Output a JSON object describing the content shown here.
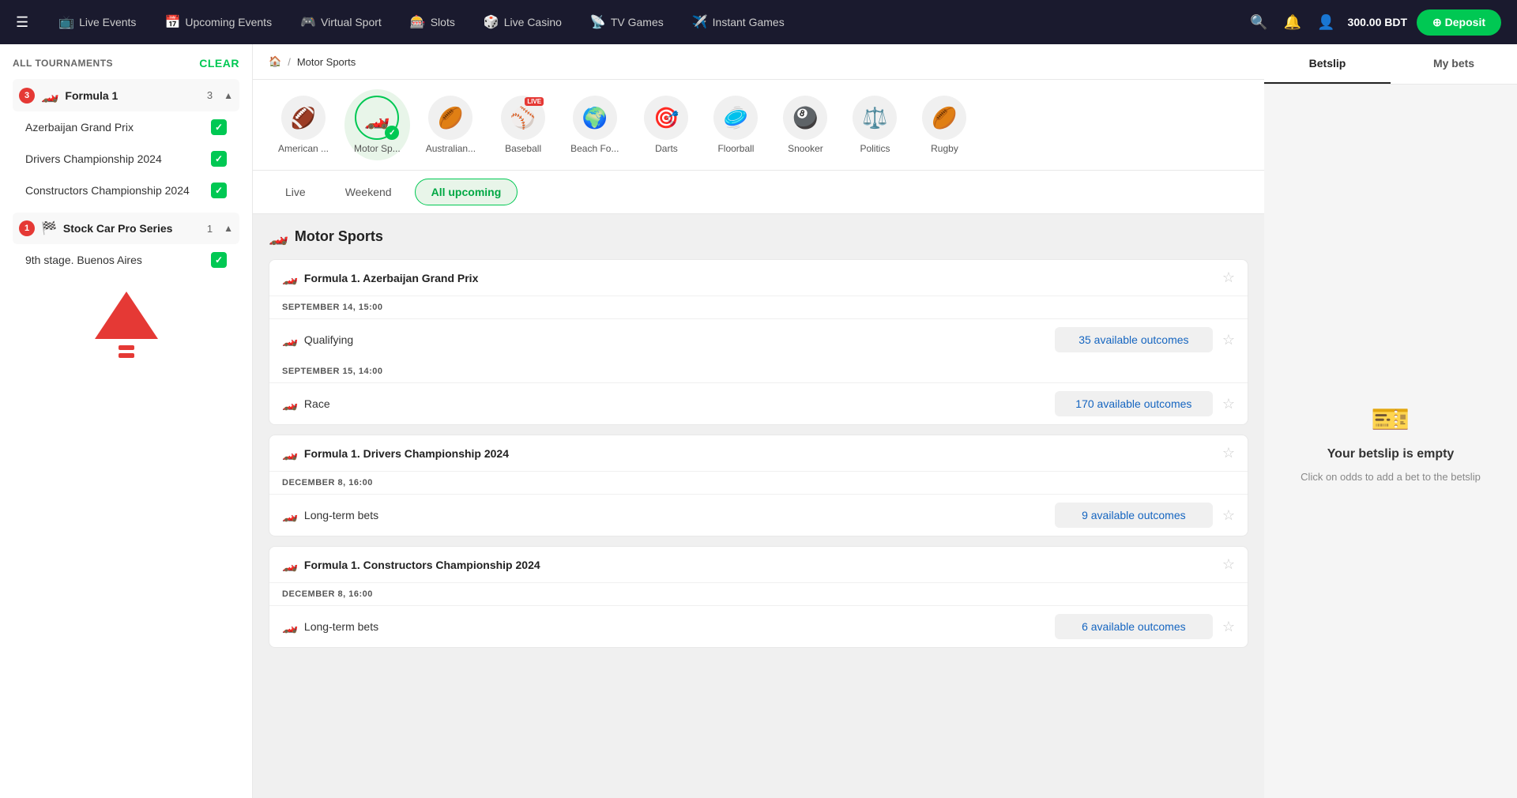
{
  "nav": {
    "hamburger": "☰",
    "items": [
      {
        "id": "live-events",
        "icon": "📺",
        "label": "Live Events"
      },
      {
        "id": "upcoming-events",
        "icon": "📅",
        "label": "Upcoming Events"
      },
      {
        "id": "virtual-sport",
        "icon": "🎮",
        "label": "Virtual Sport"
      },
      {
        "id": "slots",
        "icon": "🎰",
        "label": "Slots"
      },
      {
        "id": "live-casino",
        "icon": "🎲",
        "label": "Live Casino"
      },
      {
        "id": "tv-games",
        "icon": "📡",
        "label": "TV Games"
      },
      {
        "id": "instant-games",
        "icon": "✈️",
        "label": "Instant Games"
      }
    ],
    "balance": "300.00 BDT",
    "deposit_label": "⊕ Deposit"
  },
  "sidebar": {
    "header": "ALL TOURNAMENTS",
    "clear_label": "Clear",
    "groups": [
      {
        "id": "formula1",
        "badge": "3",
        "icon": "🏎️",
        "name": "Formula 1",
        "count": "3",
        "sub_items": [
          {
            "id": "azerbaijan",
            "label": "Azerbaijan Grand Prix",
            "checked": true
          },
          {
            "id": "drivers",
            "label": "Drivers Championship 2024",
            "checked": true
          },
          {
            "id": "constructors",
            "label": "Constructors Championship 2024",
            "checked": true
          }
        ]
      },
      {
        "id": "stockcar",
        "badge": "1",
        "icon": "🏁",
        "name": "Stock Car Pro Series",
        "count": "1",
        "sub_items": [
          {
            "id": "buenosaires",
            "label": "9th stage. Buenos Aires",
            "checked": true
          }
        ]
      }
    ]
  },
  "breadcrumb": {
    "home_icon": "🏠",
    "separator": "/",
    "current": "Motor Sports"
  },
  "sport_icons": [
    {
      "id": "american",
      "icon": "🏈",
      "label": "American ...",
      "active": false,
      "live": false
    },
    {
      "id": "motorsports",
      "icon": "🏎️",
      "label": "Motor Sp...",
      "active": true,
      "live": false
    },
    {
      "id": "australian",
      "icon": "🏉",
      "label": "Australian...",
      "active": false,
      "live": false
    },
    {
      "id": "baseball",
      "icon": "⚾",
      "label": "Baseball",
      "active": false,
      "live": true
    },
    {
      "id": "beachfootball",
      "icon": "🌍",
      "label": "Beach Fo...",
      "active": false,
      "live": false
    },
    {
      "id": "darts",
      "icon": "🎯",
      "label": "Darts",
      "active": false,
      "live": false
    },
    {
      "id": "floorball",
      "icon": "🥏",
      "label": "Floorball",
      "active": false,
      "live": false
    },
    {
      "id": "snooker",
      "icon": "🎱",
      "label": "Snooker",
      "active": false,
      "live": false
    },
    {
      "id": "politics",
      "icon": "⚖️",
      "label": "Politics",
      "active": false,
      "live": false
    },
    {
      "id": "rugby",
      "icon": "🏉",
      "label": "Rugby",
      "active": false,
      "live": false
    }
  ],
  "filter_tabs": [
    {
      "id": "live",
      "label": "Live",
      "active": false
    },
    {
      "id": "weekend",
      "label": "Weekend",
      "active": false
    },
    {
      "id": "all_upcoming",
      "label": "All upcoming",
      "active": true
    }
  ],
  "section_title": "Motor Sports",
  "section_icon": "🏎️",
  "events": [
    {
      "id": "azerbaijan",
      "title": "Formula 1. Azerbaijan Grand Prix",
      "sub_events": [
        {
          "time": "SEPTEMBER 14, 15:00",
          "rows": [
            {
              "id": "qualifying",
              "name": "Qualifying",
              "outcomes": "35 available outcomes"
            }
          ]
        },
        {
          "time": "SEPTEMBER 15, 14:00",
          "rows": [
            {
              "id": "race",
              "name": "Race",
              "outcomes": "170 available outcomes"
            }
          ]
        }
      ]
    },
    {
      "id": "drivers_champ",
      "title": "Formula 1. Drivers Championship 2024",
      "sub_events": [
        {
          "time": "DECEMBER 8, 16:00",
          "rows": [
            {
              "id": "longterm1",
              "name": "Long-term bets",
              "outcomes": "9 available outcomes"
            }
          ]
        }
      ]
    },
    {
      "id": "constructors_champ",
      "title": "Formula 1. Constructors Championship 2024",
      "sub_events": [
        {
          "time": "DECEMBER 8, 16:00",
          "rows": [
            {
              "id": "longterm2",
              "name": "Long-term bets",
              "outcomes": "6 available outcomes"
            }
          ]
        }
      ]
    }
  ],
  "betslip": {
    "tab_betslip": "Betslip",
    "tab_mybets": "My bets",
    "empty_title": "Your betslip is empty",
    "empty_text": "Click on odds to add a bet to the betslip"
  }
}
